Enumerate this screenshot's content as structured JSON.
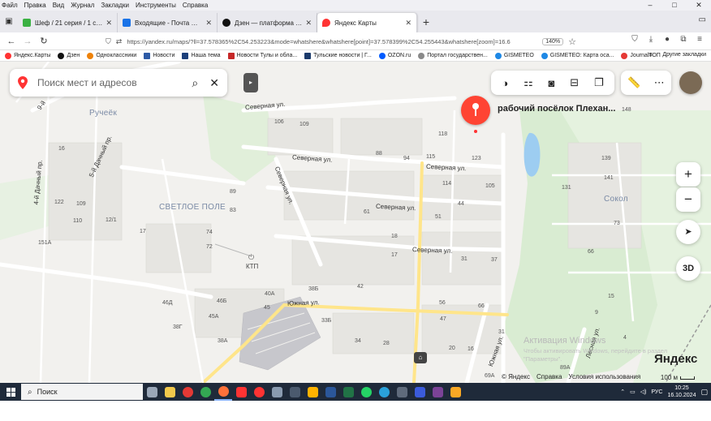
{
  "menu": [
    "Файл",
    "Правка",
    "Вид",
    "Журнал",
    "Закладки",
    "Инструменты",
    "Справка"
  ],
  "window_controls": [
    "–",
    "□",
    "✕"
  ],
  "tabs": [
    {
      "label": "Шеф / 21 серия / 1 сезон / Се",
      "icon_color": "#3bb143"
    },
    {
      "label": "Входящие - Почта Mail",
      "icon_color": "#1a73e8"
    },
    {
      "label": "Дзен — платформа для просм",
      "icon_color": "#111111"
    },
    {
      "label": "Яндекс Карты",
      "icon_color": "#ff3333"
    }
  ],
  "url": "https://yandex.ru/maps/?ll=37.578365%2C54.253223&mode=whatshere&whatshere[point]=37.578399%2C54.255443&whatshere[zoom]=16.6",
  "zoom_level": "140%",
  "bookmarks": [
    {
      "label": "Яндекс.Карты",
      "color": "#ff3333"
    },
    {
      "label": "Дзен",
      "color": "#111111"
    },
    {
      "label": "Одноклассники",
      "color": "#ee8208"
    },
    {
      "label": "Новости",
      "color": "#2d5aa6"
    },
    {
      "label": "Наша тема",
      "color": "#1c3f7a"
    },
    {
      "label": "Новости Тулы и обла...",
      "color": "#c62828"
    },
    {
      "label": "Тульские новости | Г...",
      "color": "#1b3a6b"
    },
    {
      "label": "OZON.ru",
      "color": "#005bff"
    },
    {
      "label": "Портал государствен...",
      "color": "#8a8a8a"
    },
    {
      "label": "GISMETEO",
      "color": "#1e88e5"
    },
    {
      "label": "GISMETEO: Карта оса...",
      "color": "#1e88e5"
    },
    {
      "label": "JournalТОП",
      "color": "#e53935"
    }
  ],
  "other_bookmarks": "Другие закладки",
  "map": {
    "search_placeholder": "Поиск мест и адресов",
    "placemark_label": "рабочий посёлок Плехан...",
    "zoom_in": "+",
    "zoom_out": "−",
    "mode_3d": "3D",
    "districts": [
      "СВЕТЛОЕ ПОЛЕ",
      "Сокол",
      "Ручеёк"
    ],
    "streets": [
      "Северная ул.",
      "Северная ул.",
      "Северная ул.",
      "Северная ул.",
      "Северная ул.",
      "Северная ул.",
      "Южная ул.",
      "Южная ул.",
      "Лесная ул.",
      "9-й",
      "5-й Дачный пр.",
      "4-й Дачный пр."
    ],
    "numbers": [
      "106",
      "109",
      "118",
      "88",
      "94",
      "115",
      "123",
      "114",
      "105",
      "89",
      "83",
      "61",
      "51",
      "44",
      "122",
      "109",
      "110",
      "16",
      "12/1",
      "17",
      "74",
      "72",
      "18",
      "17",
      "40А",
      "38Б",
      "42",
      "46Б",
      "46Д",
      "45А",
      "45",
      "33Б",
      "47",
      "56",
      "66",
      "38Г",
      "38А",
      "34",
      "28",
      "20",
      "16",
      "37",
      "31",
      "31",
      "69А",
      "89А",
      "139",
      "131",
      "148",
      "141",
      "73",
      "66",
      "15",
      "9",
      "4",
      "151А"
    ],
    "poi_ktp": "КТП",
    "watermark_title": "Активация Windows",
    "watermark_text": "Чтобы активировать Windows, перейдите в раздел \"Параметры\".",
    "logo": "Яндекс",
    "footer": [
      "© Яндекс",
      "Справка",
      "Условия использования"
    ],
    "scale_label": "100 м"
  },
  "taskbar": {
    "search_label": "Поиск",
    "apps": [
      {
        "name": "task-view",
        "color": "#9aa7b8"
      },
      {
        "name": "explorer",
        "color": "#f2c94c"
      },
      {
        "name": "opera",
        "color": "#e53935"
      },
      {
        "name": "chrome",
        "color": "#34a853"
      },
      {
        "name": "firefox",
        "color": "#ff7139"
      },
      {
        "name": "yandex",
        "color": "#ff3333"
      },
      {
        "name": "yandex-browser",
        "color": "#ff3333"
      },
      {
        "name": "app-gray",
        "color": "#8a9bb0"
      },
      {
        "name": "app-dark",
        "color": "#4b5a6e"
      },
      {
        "name": "app-yellow",
        "color": "#ffb300"
      },
      {
        "name": "word",
        "color": "#2b579a"
      },
      {
        "name": "excel",
        "color": "#217346"
      },
      {
        "name": "whatsapp",
        "color": "#25d366"
      },
      {
        "name": "telegram",
        "color": "#2aa1da"
      },
      {
        "name": "calculator",
        "color": "#5f6b7c"
      },
      {
        "name": "save",
        "color": "#3b5bdb"
      },
      {
        "name": "app-purple",
        "color": "#7b4397"
      },
      {
        "name": "app-amber",
        "color": "#f9a825"
      }
    ],
    "language": "РУС",
    "time": "10:25",
    "date": "16.10.2024"
  }
}
